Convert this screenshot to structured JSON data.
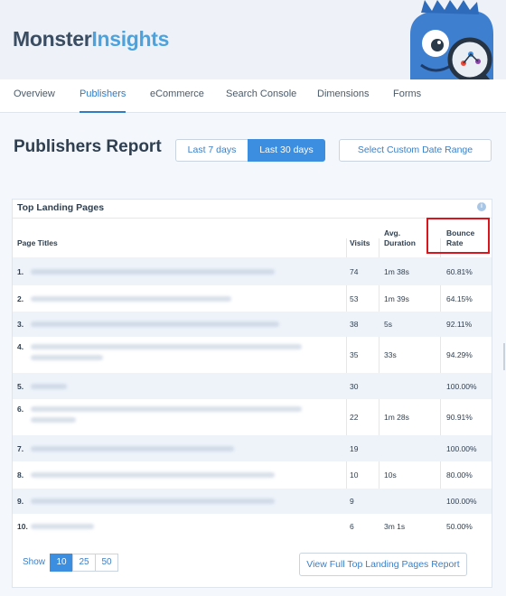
{
  "brand": {
    "part1": "Monster",
    "part2": "Insights"
  },
  "tabs": [
    {
      "label": "Overview",
      "active": false
    },
    {
      "label": "Publishers",
      "active": true
    },
    {
      "label": "eCommerce",
      "active": false
    },
    {
      "label": "Search Console",
      "active": false
    },
    {
      "label": "Dimensions",
      "active": false
    },
    {
      "label": "Forms",
      "active": false
    }
  ],
  "report": {
    "title": "Publishers Report",
    "range_7": "Last 7 days",
    "range_30": "Last 30 days",
    "custom_range": "Select Custom Date Range"
  },
  "landing": {
    "title": "Top Landing Pages",
    "headers": {
      "page_titles": "Page Titles",
      "visits": "Visits",
      "avg_duration_1": "Avg.",
      "avg_duration_2": "Duration",
      "bounce_1": "Bounce",
      "bounce_2": "Rate"
    },
    "rows": [
      {
        "num": "1.",
        "visits": "74",
        "duration": "1m 38s",
        "bounce": "60.81%"
      },
      {
        "num": "2.",
        "visits": "53",
        "duration": "1m 39s",
        "bounce": "64.15%"
      },
      {
        "num": "3.",
        "visits": "38",
        "duration": "5s",
        "bounce": "92.11%"
      },
      {
        "num": "4.",
        "visits": "35",
        "duration": "33s",
        "bounce": "94.29%"
      },
      {
        "num": "5.",
        "visits": "30",
        "duration": "",
        "bounce": "100.00%"
      },
      {
        "num": "6.",
        "visits": "22",
        "duration": "1m 28s",
        "bounce": "90.91%"
      },
      {
        "num": "7.",
        "visits": "19",
        "duration": "",
        "bounce": "100.00%"
      },
      {
        "num": "8.",
        "visits": "10",
        "duration": "10s",
        "bounce": "80.00%"
      },
      {
        "num": "9.",
        "visits": "9",
        "duration": "",
        "bounce": "100.00%"
      },
      {
        "num": "10.",
        "visits": "6",
        "duration": "3m 1s",
        "bounce": "50.00%"
      }
    ],
    "show_label": "Show",
    "page_sizes": [
      "10",
      "25",
      "50"
    ],
    "active_page_size": "10",
    "full_report": "View Full Top Landing Pages Report"
  },
  "icons": [
    "monster-mascot-icon",
    "info-icon"
  ],
  "colors": {
    "accent": "#3b8ee0",
    "highlight": "#d9161c",
    "brand_dark": "#3b4d63",
    "brand_light": "#4aa3df"
  }
}
